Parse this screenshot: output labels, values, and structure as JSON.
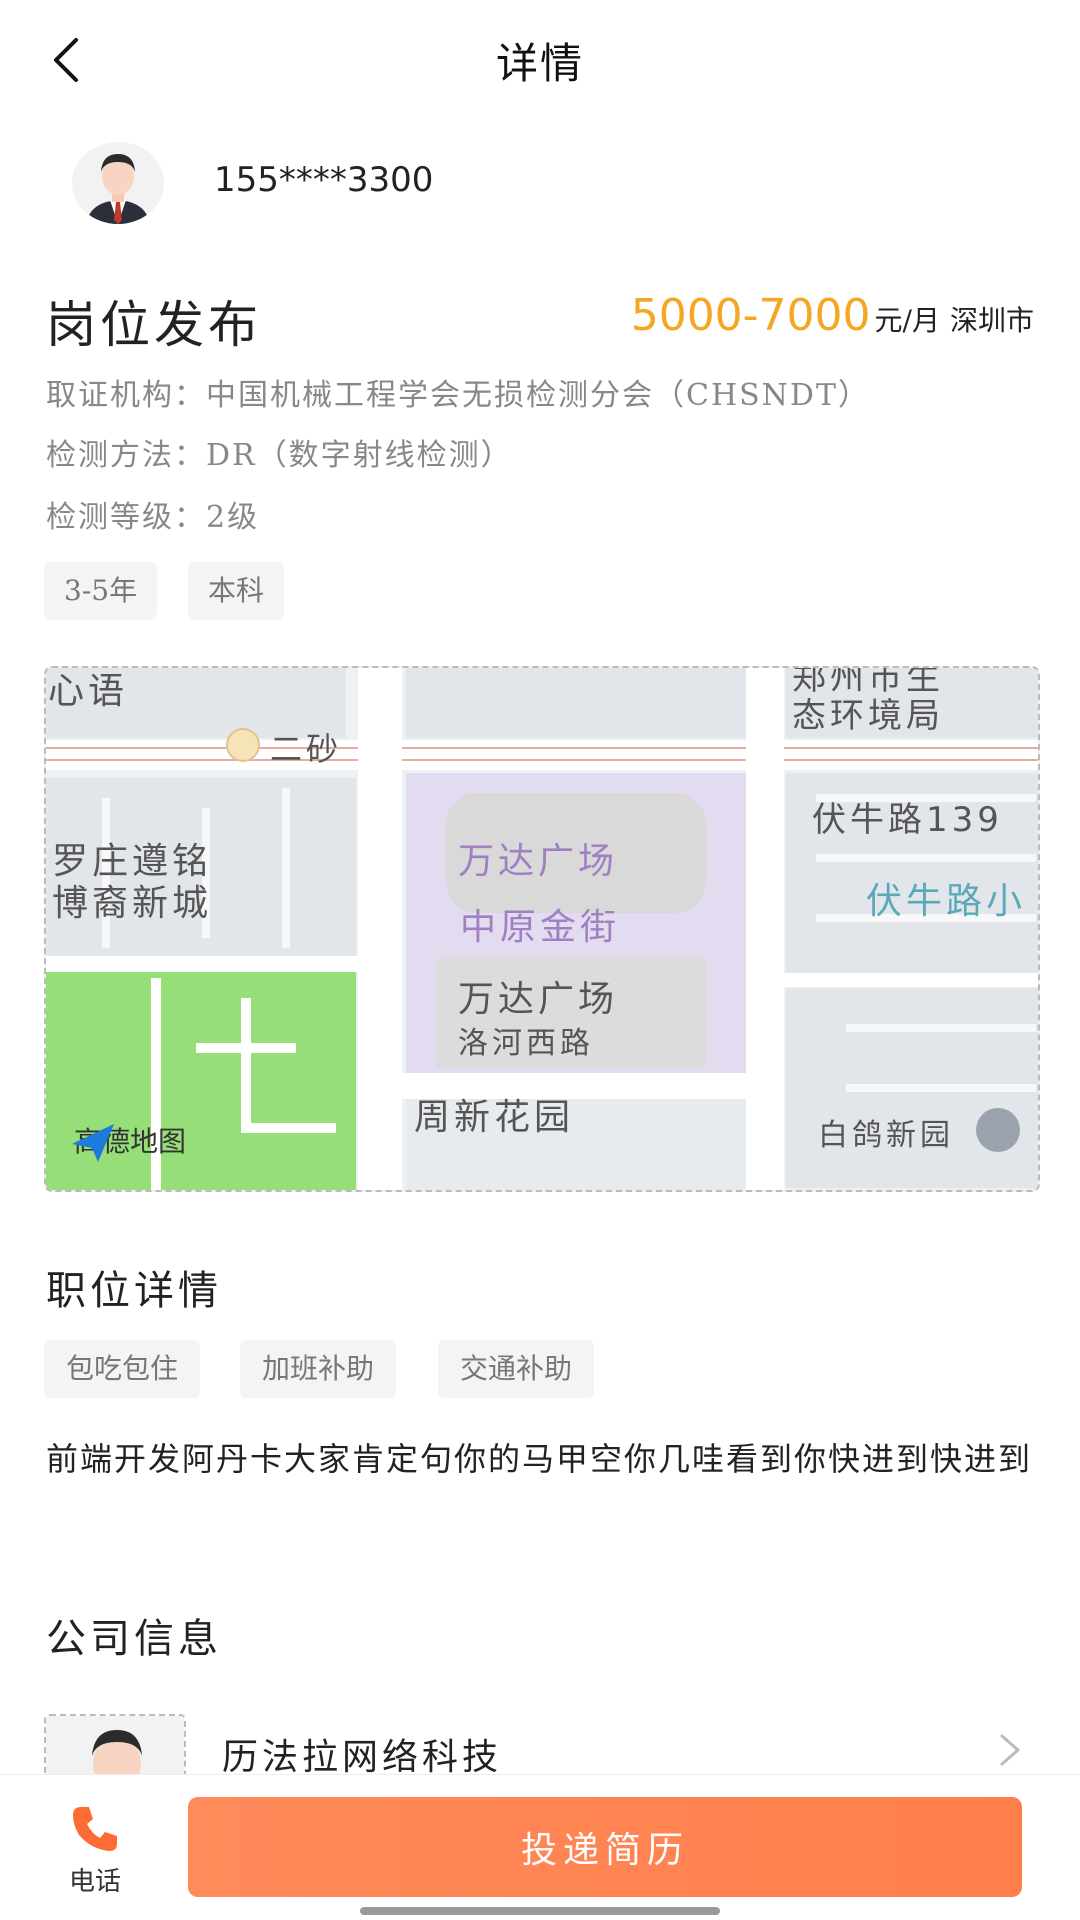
{
  "header": {
    "title": "详情"
  },
  "user": {
    "phone": "155****3300"
  },
  "job": {
    "title": "岗位发布",
    "salary": "5000-7000",
    "salary_unit": "元/月",
    "city": "深圳市",
    "info": [
      "取证机构：中国机械工程学会无损检测分会（CHSNDT）",
      "检测方法：DR（数字射线检测）",
      "检测等级：2级"
    ],
    "tags": [
      "3-5年",
      "本科"
    ]
  },
  "map": {
    "labels": [
      "心语",
      "二砂",
      "郑州市生",
      "态环境局",
      "伏牛路139",
      "罗庄遵铭",
      "博裔新城",
      "万达广场",
      "伏牛路小",
      "中原金街",
      "万达广场",
      "洛河西路",
      "周新花园",
      "白鸽新园"
    ],
    "logo_text": "高德地图",
    "colors": {
      "road": "#ffffff",
      "block": "#e2e6ea",
      "park": "#95de78",
      "plaza": "#e3dcf1",
      "rail": "#e8a9a0",
      "poi_purple": "#a080c0",
      "poi_teal": "#5aa9b8"
    }
  },
  "position_details": {
    "title": "职位详情",
    "tags": [
      "包吃包住",
      "加班补助",
      "交通补助"
    ],
    "description": "前端开发阿丹卡大家肯定句你的马甲空你几哇看到你快进到快进到"
  },
  "company": {
    "title": "公司信息",
    "name": "历法拉网络科技"
  },
  "bottom": {
    "call_label": "电话",
    "submit_label": "投递简历"
  },
  "colors": {
    "accent": "#f5a623",
    "button": "#ff7f4a",
    "call_icon": "#ff6b35"
  }
}
